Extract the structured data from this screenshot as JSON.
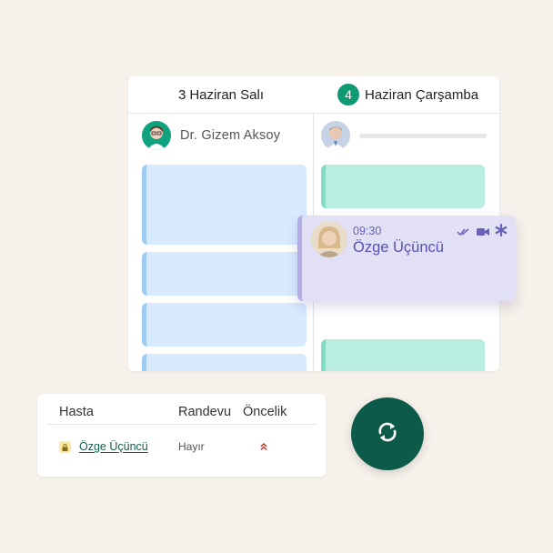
{
  "calendar": {
    "days": [
      {
        "number": "3",
        "label": "Haziran Salı"
      },
      {
        "number": "4",
        "label": "Haziran Çarşamba",
        "highlighted": true
      }
    ],
    "doctor_name": "Dr. Gizem Aksoy"
  },
  "appointment_popup": {
    "time": "09:30",
    "patient_name": "Özge Üçüncü",
    "icons": [
      "read-receipt-icon",
      "video-call-icon",
      "asterisk-icon"
    ]
  },
  "patient_table": {
    "columns": [
      "Hasta",
      "Randevu",
      "Öncelik"
    ],
    "rows": [
      {
        "patient": "Özge Üçüncü",
        "appointment": "Hayır",
        "priority_icon": "double-chevron-up-icon",
        "lock_icon": "lock-icon"
      }
    ]
  },
  "sync_button": {
    "icon": "sync-icon"
  },
  "colors": {
    "background": "#f6f1ea",
    "accent_green": "#0f9a74",
    "sync_button": "#0e5a4a",
    "slot_blue": "#d8eafe",
    "slot_teal": "#b8ede2",
    "popup_purple": "#e2e0f5",
    "popup_text": "#5a50b0"
  }
}
